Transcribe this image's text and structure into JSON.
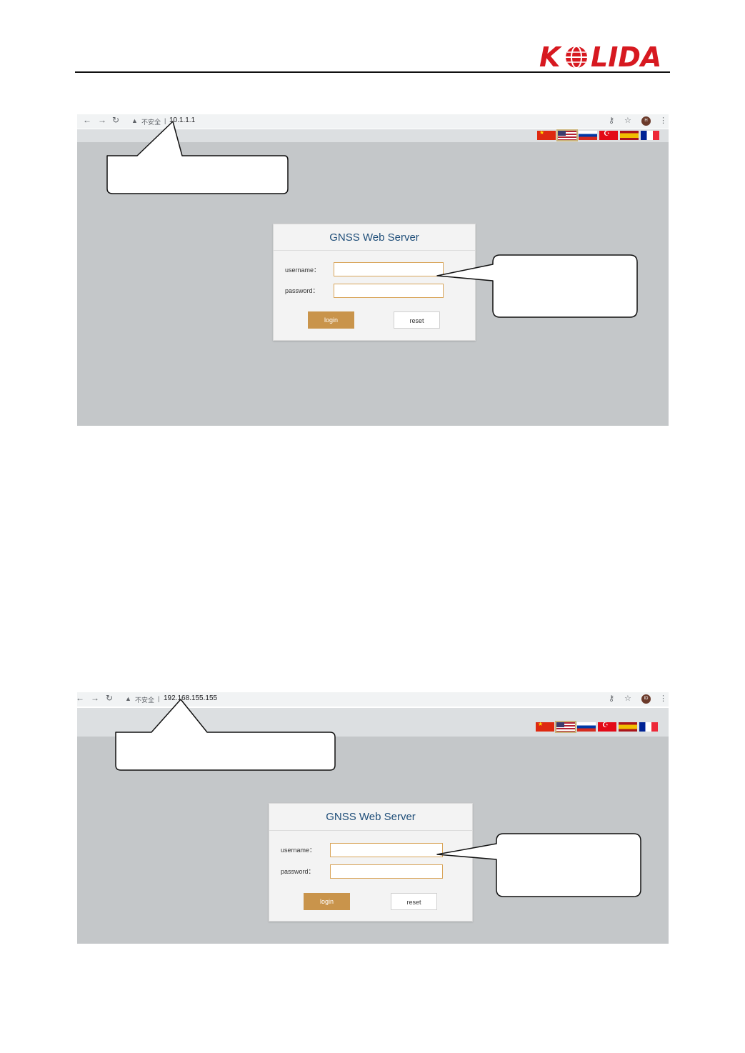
{
  "brand": {
    "logo_text": "K LIDA",
    "color": "#d71920"
  },
  "browser": {
    "back_icon": "arrow-left-icon",
    "forward_icon": "arrow-right-icon",
    "reload_icon": "reload-icon",
    "warning_icon": "warning-triangle-icon",
    "security_text": "不安全",
    "key_icon": "key-icon",
    "star_icon": "star-icon",
    "menu_icon": "kebab-menu-icon"
  },
  "flags": [
    "flag-china",
    "flag-usa",
    "flag-russia",
    "flag-turkey",
    "flag-spain",
    "flag-france"
  ],
  "screenshots": [
    {
      "url": "10.1.1.1",
      "avatar": "H",
      "login": {
        "title": "GNSS Web Server",
        "username_label": "username：",
        "password_label": "password：",
        "username_value": "",
        "password_value": "",
        "login_button": "login",
        "reset_button": "reset"
      }
    },
    {
      "url": "192.168.155.155",
      "avatar": "ID",
      "login": {
        "title": "GNSS Web Server",
        "username_label": "username：",
        "password_label": "password：",
        "username_value": "",
        "password_value": "",
        "login_button": "login",
        "reset_button": "reset"
      }
    }
  ]
}
